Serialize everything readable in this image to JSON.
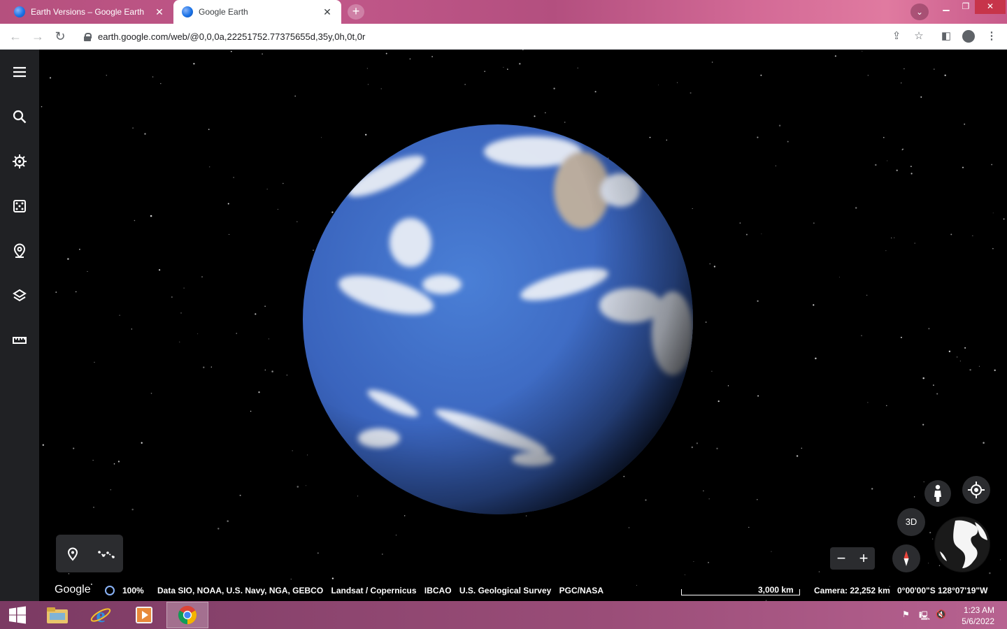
{
  "browser": {
    "tabs": [
      {
        "title": "Earth Versions – Google Earth",
        "active": false
      },
      {
        "title": "Google Earth",
        "active": true
      }
    ],
    "new_tab_symbol": "+",
    "url": "earth.google.com/web/@0,0,0a,22251752.77375655d,35y,0h,0t,0r"
  },
  "earth": {
    "rail_icons": [
      "menu-icon",
      "search-icon",
      "voyager-icon",
      "feeling-lucky-icon",
      "projects-icon",
      "map-style-icon",
      "measure-icon"
    ],
    "btn_3d_label": "3D",
    "zoom_out": "−",
    "zoom_in": "+",
    "google_label": "Google",
    "loading_percent": "100%",
    "credits": [
      "Data SIO, NOAA, U.S. Navy, NGA, GEBCO",
      "Landsat / Copernicus",
      "IBCAO",
      "U.S. Geological Survey",
      "PGC/NASA"
    ],
    "scale_label": "3,000 km",
    "camera_label": "Camera: 22,252 km",
    "coordinates": "0°00'00\"S 128°07'19\"W"
  },
  "taskbar": {
    "time": "1:23 AM",
    "date": "5/6/2022"
  },
  "colors": {
    "tabstrip": "#b5507e",
    "rail": "#202124",
    "ocean": "#3f6cc4",
    "taskbar": "#8e4670"
  }
}
